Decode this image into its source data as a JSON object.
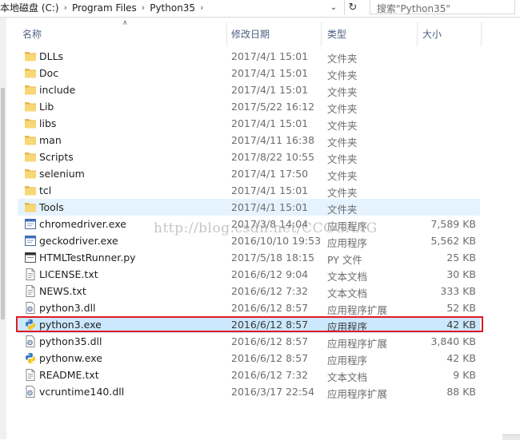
{
  "address_bar": {
    "crumbs": [
      "本地磁盘 (C:)",
      "Program Files",
      "Python35"
    ],
    "search_placeholder": "搜索\"Python35\""
  },
  "columns": {
    "name": "名称",
    "date": "修改日期",
    "type": "类型",
    "size": "大小"
  },
  "files": [
    {
      "name": "DLLs",
      "date": "2017/4/1 15:01",
      "type": "文件夹",
      "size": "",
      "icon": "folder-icon"
    },
    {
      "name": "Doc",
      "date": "2017/4/1 15:01",
      "type": "文件夹",
      "size": "",
      "icon": "folder-icon"
    },
    {
      "name": "include",
      "date": "2017/4/1 15:01",
      "type": "文件夹",
      "size": "",
      "icon": "folder-icon"
    },
    {
      "name": "Lib",
      "date": "2017/5/22 16:12",
      "type": "文件夹",
      "size": "",
      "icon": "folder-icon"
    },
    {
      "name": "libs",
      "date": "2017/4/1 15:01",
      "type": "文件夹",
      "size": "",
      "icon": "folder-icon"
    },
    {
      "name": "man",
      "date": "2017/4/11 16:38",
      "type": "文件夹",
      "size": "",
      "icon": "folder-icon"
    },
    {
      "name": "Scripts",
      "date": "2017/8/22 10:55",
      "type": "文件夹",
      "size": "",
      "icon": "folder-icon"
    },
    {
      "name": "selenium",
      "date": "2017/4/1 17:50",
      "type": "文件夹",
      "size": "",
      "icon": "folder-icon"
    },
    {
      "name": "tcl",
      "date": "2017/4/1 15:01",
      "type": "文件夹",
      "size": "",
      "icon": "folder-icon"
    },
    {
      "name": "Tools",
      "date": "2017/4/1 15:01",
      "type": "文件夹",
      "size": "",
      "icon": "folder-icon",
      "state": "hover"
    },
    {
      "name": "chromedriver.exe",
      "date": "2017/3/8 14:04",
      "type": "应用程序",
      "size": "7,589 KB",
      "icon": "exe-icon"
    },
    {
      "name": "geckodriver.exe",
      "date": "2016/10/10 19:53",
      "type": "应用程序",
      "size": "5,562 KB",
      "icon": "exe-icon"
    },
    {
      "name": "HTMLTestRunner.py",
      "date": "2017/5/18 18:15",
      "type": "PY 文件",
      "size": "25 KB",
      "icon": "py-file-icon"
    },
    {
      "name": "LICENSE.txt",
      "date": "2016/6/12 9:04",
      "type": "文本文档",
      "size": "30 KB",
      "icon": "text-file-icon"
    },
    {
      "name": "NEWS.txt",
      "date": "2016/6/12 7:32",
      "type": "文本文档",
      "size": "333 KB",
      "icon": "text-file-icon"
    },
    {
      "name": "python3.dll",
      "date": "2016/6/12 8:57",
      "type": "应用程序扩展",
      "size": "52 KB",
      "icon": "dll-icon"
    },
    {
      "name": "python3.exe",
      "date": "2016/6/12 8:57",
      "type": "应用程序",
      "size": "42 KB",
      "icon": "python-exe-icon",
      "state": "selected"
    },
    {
      "name": "python35.dll",
      "date": "2016/6/12 8:57",
      "type": "应用程序扩展",
      "size": "3,840 KB",
      "icon": "dll-icon"
    },
    {
      "name": "pythonw.exe",
      "date": "2016/6/12 8:57",
      "type": "应用程序",
      "size": "42 KB",
      "icon": "python-exe-icon"
    },
    {
      "name": "README.txt",
      "date": "2016/6/12 7:32",
      "type": "文本文档",
      "size": "9 KB",
      "icon": "text-file-icon"
    },
    {
      "name": "vcruntime140.dll",
      "date": "2016/3/17 22:54",
      "type": "应用程序扩展",
      "size": "88 KB",
      "icon": "dll-icon"
    }
  ],
  "watermark": "http://blog.csdn.net/CCGGAAG",
  "colors": {
    "selected_row": "#cce8ff",
    "hover_row": "#e5f3ff",
    "annotation_box": "#e01b24",
    "folder": "#f8d775"
  }
}
